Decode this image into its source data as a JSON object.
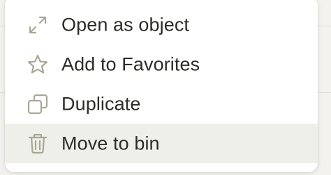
{
  "context_menu": {
    "items": [
      {
        "label": "Open as object",
        "icon": "expand-arrows-icon",
        "active": false
      },
      {
        "label": "Add to Favorites",
        "icon": "star-icon",
        "active": false
      },
      {
        "label": "Duplicate",
        "icon": "duplicate-icon",
        "active": false
      },
      {
        "label": "Move to bin",
        "icon": "trash-icon",
        "active": true
      }
    ],
    "colors": {
      "icon": "#a9a794",
      "text": "#2d2c29",
      "hover_bg": "#efefe9",
      "menu_bg": "#ffffff"
    }
  }
}
